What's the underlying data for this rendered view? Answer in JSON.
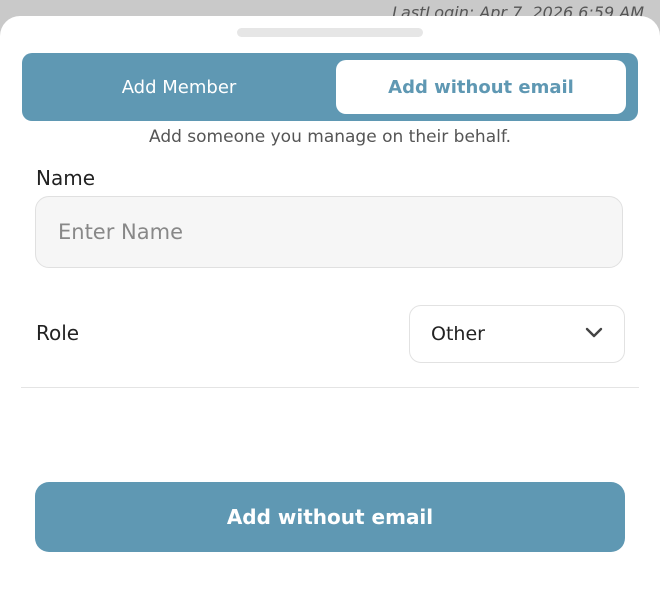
{
  "background": {
    "last_login": "LastLogin: Apr 7, 2026 6:59 AM"
  },
  "tabs": {
    "add_member": "Add Member",
    "add_without_email": "Add without email",
    "selected": "add_without_email"
  },
  "subtitle": "Add someone you manage on their behalf.",
  "form": {
    "name_label": "Name",
    "name_placeholder": "Enter Name",
    "name_value": "",
    "role_label": "Role",
    "role_value": "Other"
  },
  "submit_label": "Add without email",
  "colors": {
    "accent": "#5f98b3",
    "input_bg": "#f6f6f6"
  },
  "icons": {
    "role_dropdown": "chevron-down-icon"
  }
}
